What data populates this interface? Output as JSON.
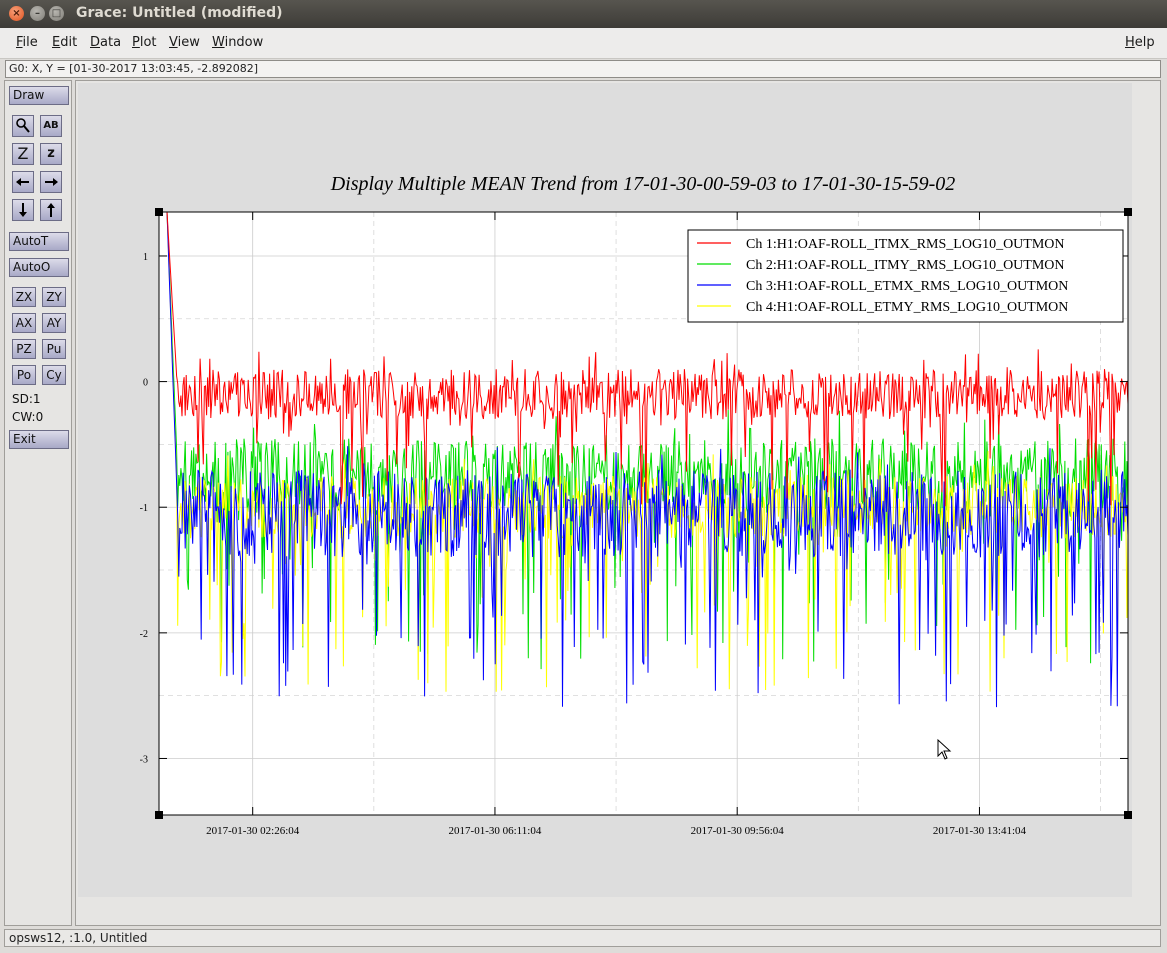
{
  "window": {
    "title": "Grace: Untitled (modified)",
    "close_glyph": "×",
    "min_glyph": "–",
    "max_glyph": "□"
  },
  "menu": {
    "file": "File",
    "edit": "Edit",
    "data": "Data",
    "plot": "Plot",
    "view": "View",
    "window": "Window",
    "help": "Help"
  },
  "coord_readout": "G0: X, Y = [01-30-2017 13:03:45, -2.892082]",
  "toolbar": {
    "draw": "Draw",
    "autot": "AutoT",
    "autoo": "AutoO",
    "zx": "ZX",
    "zy": "ZY",
    "ax": "AX",
    "ay": "AY",
    "pz": "PZ",
    "pu": "Pu",
    "po": "Po",
    "cy": "Cy",
    "zoom_z": "Z",
    "zoom_z_small": "z",
    "text_icon": "AB",
    "sd": "SD:1",
    "cw": "CW:0",
    "exit": "Exit"
  },
  "status": "opsws12, :1.0, Untitled",
  "chart_data": {
    "type": "line",
    "title": "Display Multiple MEAN Trend from 17-01-30-00-59-03 to 17-01-30-15-59-02",
    "x_start": "2017-01-30 00:59:03",
    "x_end": "2017-01-30 15:59:02",
    "x_tick_labels": [
      "2017-01-30 02:26:04",
      "2017-01-30 06:11:04",
      "2017-01-30 09:56:04",
      "2017-01-30 13:41:04"
    ],
    "y_ticks": [
      1,
      0,
      -1,
      -2,
      -3
    ],
    "ylim": [
      -3.45,
      1.35
    ],
    "grid": true,
    "legend_position": "top-right",
    "series": [
      {
        "name": "Ch 1:H1:OAF-ROLL_ITMX_RMS_LOG10_OUTMON",
        "color": "#ff0000",
        "mean": -0.1,
        "spread": 0.2,
        "low_spike": -1.0
      },
      {
        "name": "Ch 2:H1:OAF-ROLL_ITMY_RMS_LOG10_OUTMON",
        "color": "#00dd00",
        "mean": -0.75,
        "spread": 0.3,
        "low_spike": -2.3
      },
      {
        "name": "Ch 3:H1:OAF-ROLL_ETMX_RMS_LOG10_OUTMON",
        "color": "#0000ff",
        "mean": -1.05,
        "spread": 0.35,
        "low_spike": -2.6
      },
      {
        "name": "Ch 4:H1:OAF-ROLL_ETMY_RMS_LOG10_OUTMON",
        "color": "#ffff00",
        "mean": -1.0,
        "spread": 0.25,
        "low_spike": -2.5
      }
    ]
  }
}
